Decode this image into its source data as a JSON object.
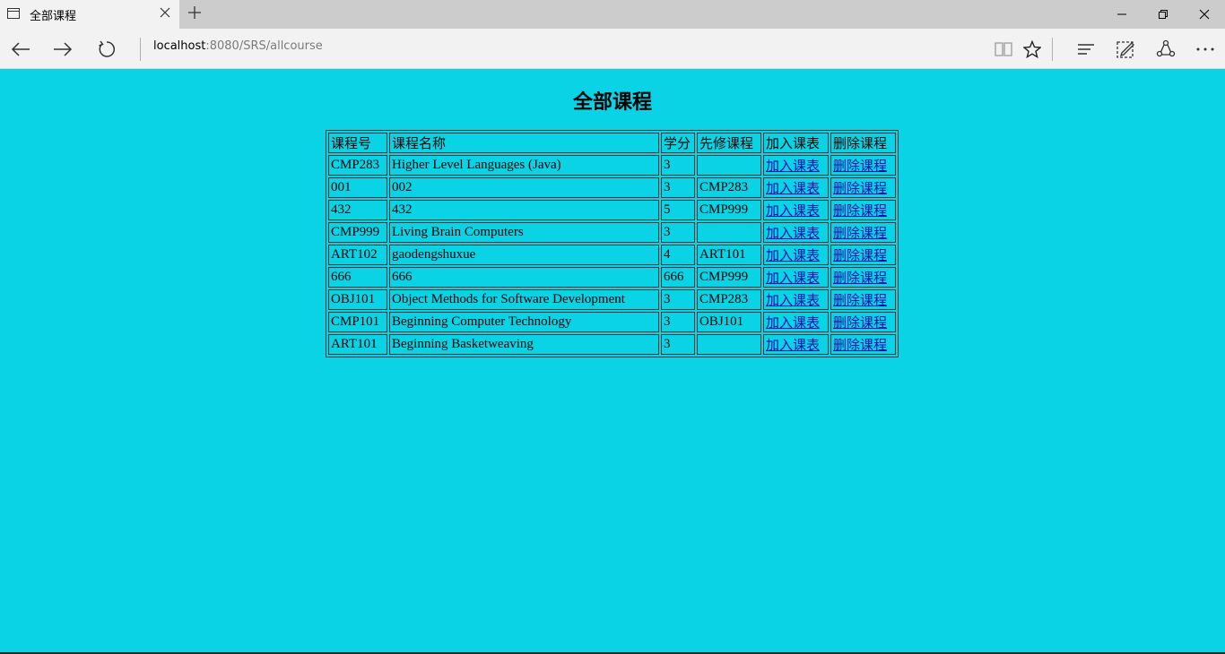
{
  "browser": {
    "tab_title": "全部课程",
    "address_host": "localhost",
    "address_path": ":8080/SRS/allcourse",
    "icons": [
      "page-icon",
      "close-icon",
      "plus-icon",
      "minimize-icon",
      "restore-icon",
      "window-close-icon",
      "back-icon",
      "forward-icon",
      "refresh-icon",
      "reading-view-icon",
      "favorite-star-icon",
      "hub-icon",
      "web-note-icon",
      "share-icon",
      "more-icon"
    ]
  },
  "page": {
    "title": "全部课程",
    "headers": [
      "课程号",
      "课程名称",
      "学分",
      "先修课程",
      "加入课表",
      "删除课程"
    ],
    "rows": [
      {
        "id": "CMP283",
        "name": "Higher Level Languages (Java)",
        "credits": "3",
        "prereq": "",
        "add": "加入课表",
        "delete": "删除课程"
      },
      {
        "id": "001",
        "name": "002",
        "credits": "3",
        "prereq": "CMP283",
        "add": "加入课表",
        "delete": "删除课程"
      },
      {
        "id": "432",
        "name": "432",
        "credits": "5",
        "prereq": "CMP999",
        "add": "加入课表",
        "delete": "删除课程"
      },
      {
        "id": "CMP999",
        "name": "Living Brain Computers",
        "credits": "3",
        "prereq": "",
        "add": "加入课表",
        "delete": "删除课程"
      },
      {
        "id": "ART102",
        "name": "gaodengshuxue",
        "credits": "4",
        "prereq": "ART101",
        "add": "加入课表",
        "delete": "删除课程"
      },
      {
        "id": "666",
        "name": "666",
        "credits": "666",
        "prereq": "CMP999",
        "add": "加入课表",
        "delete": "删除课程"
      },
      {
        "id": "OBJ101",
        "name": "Object Methods for Software Development",
        "credits": "3",
        "prereq": "CMP283",
        "add": "加入课表",
        "delete": "删除课程"
      },
      {
        "id": "CMP101",
        "name": "Beginning Computer Technology",
        "credits": "3",
        "prereq": "OBJ101",
        "add": "加入课表",
        "delete": "删除课程"
      },
      {
        "id": "ART101",
        "name": "Beginning Basketweaving",
        "credits": "3",
        "prereq": "",
        "add": "加入课表",
        "delete": "删除课程"
      }
    ]
  },
  "colors": {
    "page_background": "#0ad3e6",
    "link": "#1a0dab",
    "chrome_tab": "#f2f2f2",
    "chrome_titlebar": "#cccccc"
  }
}
